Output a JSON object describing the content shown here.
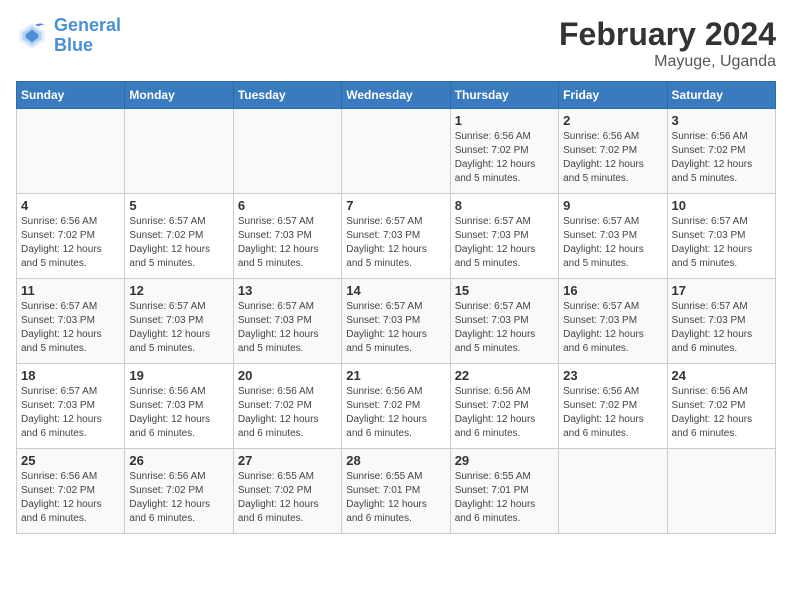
{
  "logo": {
    "line1": "General",
    "line2": "Blue"
  },
  "title": "February 2024",
  "location": "Mayuge, Uganda",
  "days_header": [
    "Sunday",
    "Monday",
    "Tuesday",
    "Wednesday",
    "Thursday",
    "Friday",
    "Saturday"
  ],
  "weeks": [
    [
      {
        "day": "",
        "info": ""
      },
      {
        "day": "",
        "info": ""
      },
      {
        "day": "",
        "info": ""
      },
      {
        "day": "",
        "info": ""
      },
      {
        "day": "1",
        "info": "Sunrise: 6:56 AM\nSunset: 7:02 PM\nDaylight: 12 hours\nand 5 minutes."
      },
      {
        "day": "2",
        "info": "Sunrise: 6:56 AM\nSunset: 7:02 PM\nDaylight: 12 hours\nand 5 minutes."
      },
      {
        "day": "3",
        "info": "Sunrise: 6:56 AM\nSunset: 7:02 PM\nDaylight: 12 hours\nand 5 minutes."
      }
    ],
    [
      {
        "day": "4",
        "info": "Sunrise: 6:56 AM\nSunset: 7:02 PM\nDaylight: 12 hours\nand 5 minutes."
      },
      {
        "day": "5",
        "info": "Sunrise: 6:57 AM\nSunset: 7:02 PM\nDaylight: 12 hours\nand 5 minutes."
      },
      {
        "day": "6",
        "info": "Sunrise: 6:57 AM\nSunset: 7:03 PM\nDaylight: 12 hours\nand 5 minutes."
      },
      {
        "day": "7",
        "info": "Sunrise: 6:57 AM\nSunset: 7:03 PM\nDaylight: 12 hours\nand 5 minutes."
      },
      {
        "day": "8",
        "info": "Sunrise: 6:57 AM\nSunset: 7:03 PM\nDaylight: 12 hours\nand 5 minutes."
      },
      {
        "day": "9",
        "info": "Sunrise: 6:57 AM\nSunset: 7:03 PM\nDaylight: 12 hours\nand 5 minutes."
      },
      {
        "day": "10",
        "info": "Sunrise: 6:57 AM\nSunset: 7:03 PM\nDaylight: 12 hours\nand 5 minutes."
      }
    ],
    [
      {
        "day": "11",
        "info": "Sunrise: 6:57 AM\nSunset: 7:03 PM\nDaylight: 12 hours\nand 5 minutes."
      },
      {
        "day": "12",
        "info": "Sunrise: 6:57 AM\nSunset: 7:03 PM\nDaylight: 12 hours\nand 5 minutes."
      },
      {
        "day": "13",
        "info": "Sunrise: 6:57 AM\nSunset: 7:03 PM\nDaylight: 12 hours\nand 5 minutes."
      },
      {
        "day": "14",
        "info": "Sunrise: 6:57 AM\nSunset: 7:03 PM\nDaylight: 12 hours\nand 5 minutes."
      },
      {
        "day": "15",
        "info": "Sunrise: 6:57 AM\nSunset: 7:03 PM\nDaylight: 12 hours\nand 5 minutes."
      },
      {
        "day": "16",
        "info": "Sunrise: 6:57 AM\nSunset: 7:03 PM\nDaylight: 12 hours\nand 6 minutes."
      },
      {
        "day": "17",
        "info": "Sunrise: 6:57 AM\nSunset: 7:03 PM\nDaylight: 12 hours\nand 6 minutes."
      }
    ],
    [
      {
        "day": "18",
        "info": "Sunrise: 6:57 AM\nSunset: 7:03 PM\nDaylight: 12 hours\nand 6 minutes."
      },
      {
        "day": "19",
        "info": "Sunrise: 6:56 AM\nSunset: 7:03 PM\nDaylight: 12 hours\nand 6 minutes."
      },
      {
        "day": "20",
        "info": "Sunrise: 6:56 AM\nSunset: 7:02 PM\nDaylight: 12 hours\nand 6 minutes."
      },
      {
        "day": "21",
        "info": "Sunrise: 6:56 AM\nSunset: 7:02 PM\nDaylight: 12 hours\nand 6 minutes."
      },
      {
        "day": "22",
        "info": "Sunrise: 6:56 AM\nSunset: 7:02 PM\nDaylight: 12 hours\nand 6 minutes."
      },
      {
        "day": "23",
        "info": "Sunrise: 6:56 AM\nSunset: 7:02 PM\nDaylight: 12 hours\nand 6 minutes."
      },
      {
        "day": "24",
        "info": "Sunrise: 6:56 AM\nSunset: 7:02 PM\nDaylight: 12 hours\nand 6 minutes."
      }
    ],
    [
      {
        "day": "25",
        "info": "Sunrise: 6:56 AM\nSunset: 7:02 PM\nDaylight: 12 hours\nand 6 minutes."
      },
      {
        "day": "26",
        "info": "Sunrise: 6:56 AM\nSunset: 7:02 PM\nDaylight: 12 hours\nand 6 minutes."
      },
      {
        "day": "27",
        "info": "Sunrise: 6:55 AM\nSunset: 7:02 PM\nDaylight: 12 hours\nand 6 minutes."
      },
      {
        "day": "28",
        "info": "Sunrise: 6:55 AM\nSunset: 7:01 PM\nDaylight: 12 hours\nand 6 minutes."
      },
      {
        "day": "29",
        "info": "Sunrise: 6:55 AM\nSunset: 7:01 PM\nDaylight: 12 hours\nand 6 minutes."
      },
      {
        "day": "",
        "info": ""
      },
      {
        "day": "",
        "info": ""
      }
    ]
  ]
}
